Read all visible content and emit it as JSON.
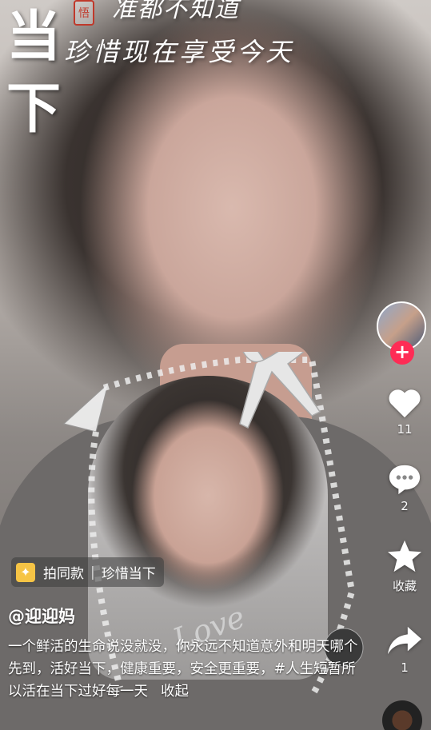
{
  "overlay": {
    "big_char_1": "当",
    "big_char_2": "下",
    "seal_char": "悟",
    "line1": "准都不知道",
    "line2": "珍惜现在享受今天"
  },
  "rail": {
    "likes": "11",
    "comments": "2",
    "favorite_label": "收藏",
    "shares": "1"
  },
  "anchor": {
    "label": "拍同款",
    "separator": "|",
    "title": "珍惜当下"
  },
  "author": "@迎迎妈",
  "description": "一个鲜活的生命说没就没，你永远不知道意外和明天哪个先到，活好当下，健康重要，安全更重要，#人生短暂所以活在当下过好每一天",
  "collapse_label": "收起",
  "colors": {
    "follow_button": "#fe2c55",
    "anchor_icon": "#f6c445"
  }
}
